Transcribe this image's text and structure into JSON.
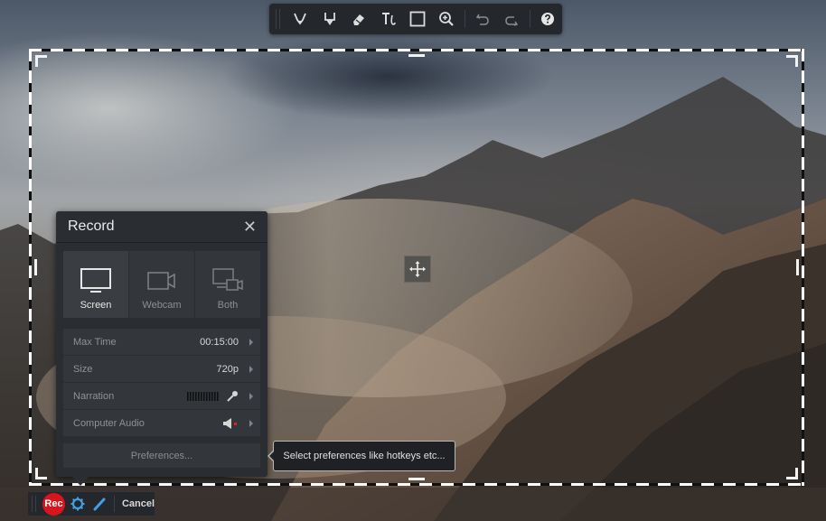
{
  "toolbar": {
    "tools": [
      {
        "name": "pen-tool",
        "label": "Pen"
      },
      {
        "name": "highlighter-tool",
        "label": "Highlighter"
      },
      {
        "name": "eraser-tool",
        "label": "Eraser"
      },
      {
        "name": "text-tool",
        "label": "Text"
      },
      {
        "name": "rectangle-tool",
        "label": "Rectangle"
      },
      {
        "name": "zoom-tool",
        "label": "Zoom"
      },
      {
        "name": "undo",
        "label": "Undo"
      },
      {
        "name": "redo",
        "label": "Redo"
      },
      {
        "name": "help",
        "label": "Help"
      }
    ]
  },
  "record_panel": {
    "title": "Record",
    "close_glyph": "✕",
    "modes": [
      {
        "label": "Screen",
        "icon": "monitor-icon",
        "active": true
      },
      {
        "label": "Webcam",
        "icon": "webcam-icon",
        "active": false
      },
      {
        "label": "Both",
        "icon": "screen-and-webcam-icon",
        "active": false
      }
    ],
    "settings": [
      {
        "label": "Max Time",
        "value": "00:15:00"
      },
      {
        "label": "Size",
        "value": "720p"
      },
      {
        "label": "Narration",
        "value": "",
        "icon": "microphone-icon"
      },
      {
        "label": "Computer Audio",
        "value": "",
        "icon": "speaker-muted-icon"
      }
    ],
    "preferences_label": "Preferences..."
  },
  "tooltip": {
    "text": "Select preferences like hotkeys etc..."
  },
  "bottom_bar": {
    "rec_label": "Rec",
    "cancel_label": "Cancel"
  },
  "colors": {
    "rec_red": "#d8141c",
    "accent_blue": "#3fa0e8",
    "muted_red": "#e0202a"
  }
}
